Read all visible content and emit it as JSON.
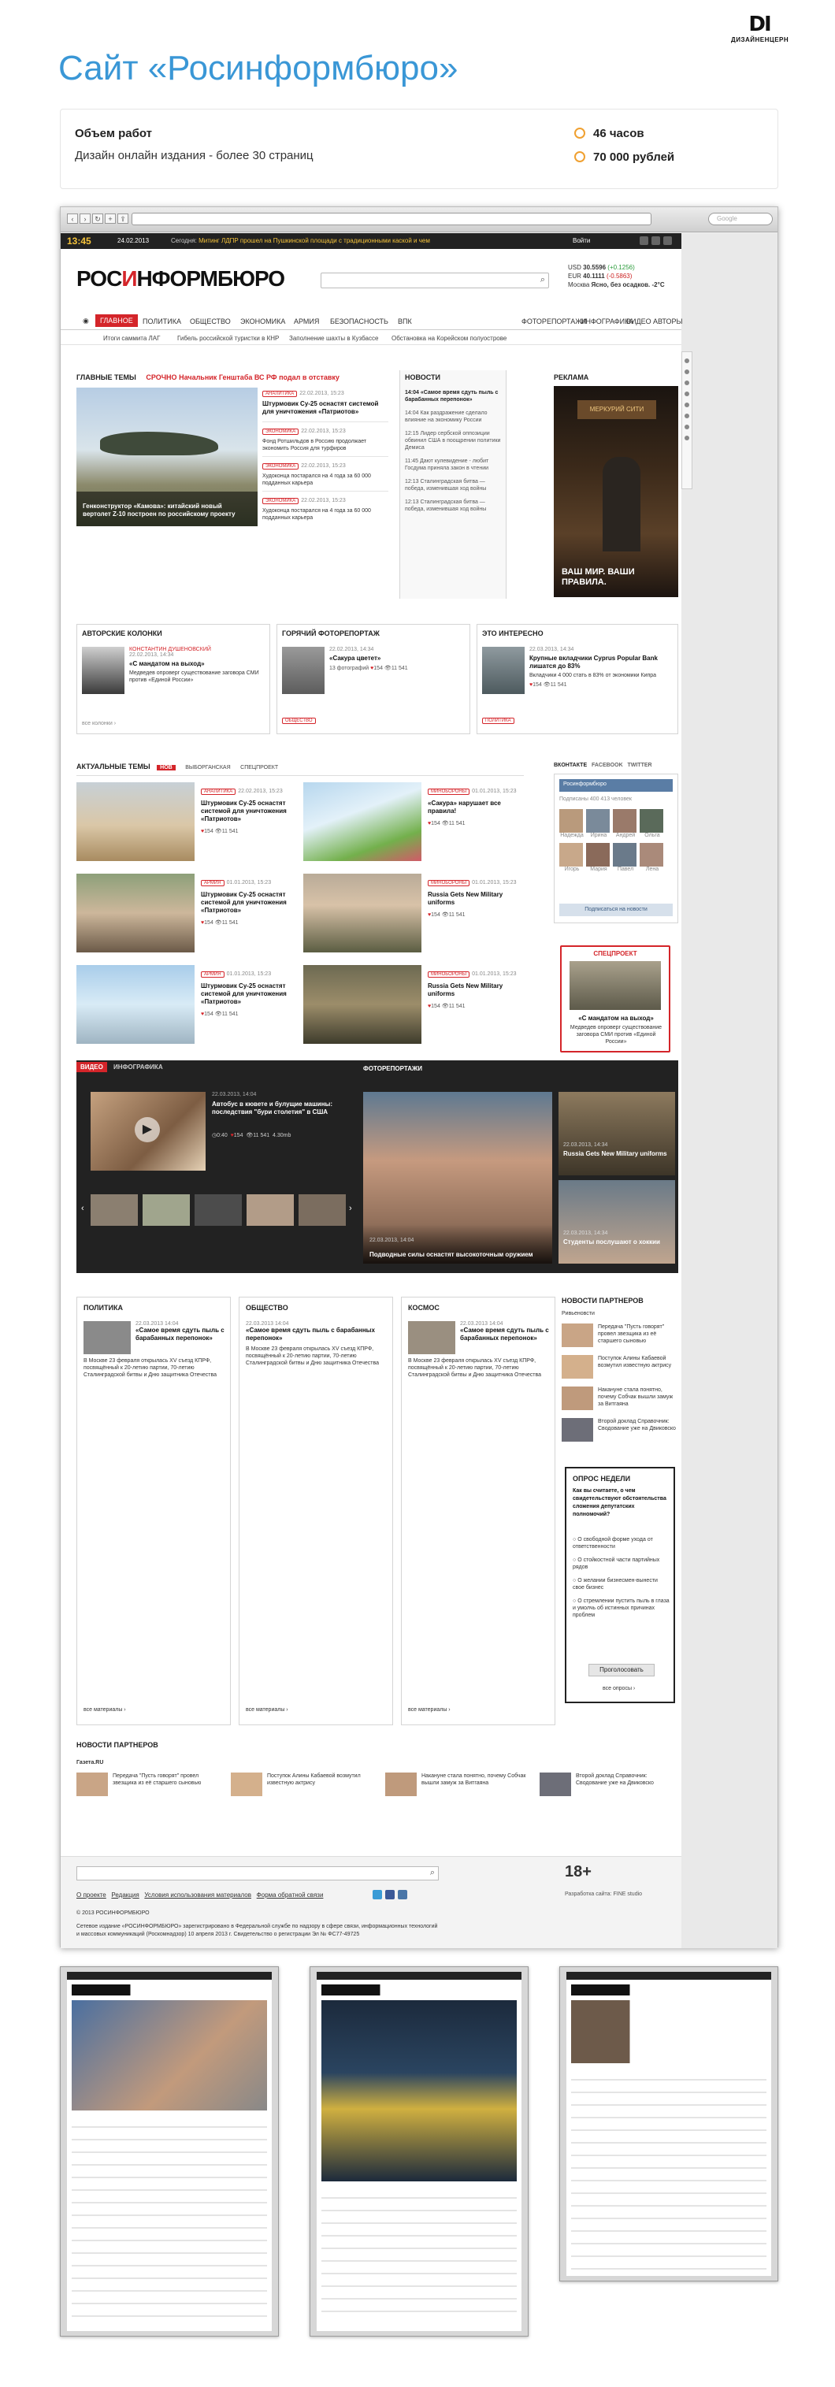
{
  "brand": {
    "mark": "DI",
    "name": "ДИЗАЙНЕНЦЕРН"
  },
  "title": "Сайт «Росинформбюро»",
  "project": {
    "scope_label": "Объем работ",
    "scope_value": "Дизайн онлайн издания - более 30 страниц",
    "hours": "46 часов",
    "price": "70 000 рублей"
  },
  "browser": {
    "search_placeholder": "Google"
  },
  "site": {
    "topbar": {
      "time": "13:45",
      "date": "24.02.2013",
      "news_prefix": "Сегодня:",
      "news_text": "Митинг ЛДПР прошел на Пушкинской площади с традиционными каской и чем",
      "login": "Войти"
    },
    "logo_a": "РОС",
    "logo_b": "И",
    "logo_c": "НФОРМБЮРО",
    "rates": [
      {
        "label": "USD",
        "value": "30.5596",
        "delta": "(+0.1256)"
      },
      {
        "label": "EUR",
        "value": "40.1111",
        "delta": "(-0.5863)"
      },
      {
        "label": "Москва",
        "value": "Ясно, без осадков. -2°C",
        "delta": ""
      }
    ],
    "nav": [
      "ГЛАВНОЕ",
      "ПОЛИТИКА",
      "ОБЩЕСТВО",
      "ЭКОНОМИКА",
      "АРМИЯ",
      "БЕЗОПАСНОСТЬ",
      "ВПК",
      "ФОТОРЕПОРТАЖИ",
      "ИНФОГРАФИКА",
      "ВИДЕО",
      "АВТОРЫ"
    ],
    "subnav": [
      "Итоги саммита ЛАГ",
      "Гибель российской туристки в КНР",
      "Заполнение шахты в Кузбассе",
      "Обстановка на Корейском полуострове"
    ],
    "main": {
      "header": "ГЛАВНЫЕ ТЕМЫ",
      "urgent_label": "СРОЧНО",
      "urgent_text": "Начальник Генштаба ВС РФ подал в отставку",
      "lead_caption": "Генконструктор «Камова»: китайский новый вертолет Z-10 построен по российскому проекту",
      "items": [
        {
          "tag": "АНАЛИТИКА",
          "date": "22.02.2013, 15:23",
          "title": "Штурмовик Су-25 оснастят системой для уничтожения «Патриотов»"
        },
        {
          "tag": "ЭКОНОМИКА",
          "date": "22.02.2013, 15:23",
          "title": "Фонд Ротшильдов в Россию продолжает экономить Россия для турфиров"
        },
        {
          "tag": "ЭКОНОМИКА",
          "date": "22.02.2013, 15:23",
          "title": "Худоконца постарался на 4 года за 60 000 подданных карьера"
        },
        {
          "tag": "ЭКОНОМИКА",
          "date": "22.02.2013, 15:23",
          "title": "Худоконца постарался на 4 года за 60 000 подданных карьера"
        }
      ]
    },
    "news": {
      "header": "НОВОСТИ",
      "items": [
        {
          "time": "14:04",
          "text": "«Самое время сдуть пыль с барабанных перепонок»"
        },
        {
          "time": "14:04",
          "text": "Как раздражение сделало влияние на экономику России"
        },
        {
          "time": "12:15",
          "text": "Лидер сербской оппозиции обвинил США в поощрении политики Демиса"
        },
        {
          "time": "11:45",
          "text": "Дают кулевидение - любит Госдума приняла закон в чтении"
        },
        {
          "time": "12:13",
          "text": "Сталинградская битва — победа, изменившая ход войны"
        },
        {
          "time": "12:13",
          "text": "Сталинградская битва — победа, изменившая ход войны"
        }
      ]
    },
    "ad": {
      "header": "РЕКЛАМА",
      "brand": "МЕРКУРИЙ СИТИ",
      "slogan": "ВАШ МИР. ВАШИ ПРАВИЛА."
    },
    "columns": {
      "header": "АВТОРСКИЕ КОЛОНКИ",
      "author": "КОНСТАНТИН ДУШЕНОВСКИЙ",
      "date": "22.02.2013, 14:34",
      "title": "«С мандатом на выход»",
      "text": "Медведев опроверг существование заговора СМИ против «Единой России»",
      "more": "все колонки ›"
    },
    "hotphoto": {
      "header": "ГОРЯЧИЙ ФОТОРЕПОРТАЖ",
      "date": "22.02.2013, 14:34",
      "title": "«Сакура цветет»",
      "photos": "13 фотографий",
      "likes": "154",
      "views": "11 541",
      "tag": "ОБЩЕСТВО"
    },
    "interesting": {
      "header": "ЭТО ИНТЕРЕСНО",
      "date": "22.03.2013, 14:34",
      "title": "Крупные вкладчики Cyprus Popular Bank лишатся до 83%",
      "text": "Вкладчики 4 000 стать в 83% от экономики Кипра",
      "likes": "154",
      "views": "11 541",
      "tag": "ПОЛИТИКА"
    },
    "topics": {
      "header": "АКТУАЛЬНЫЕ ТЕМЫ",
      "badge": "НОВ",
      "tabs": [
        "ВЫБОРГАНСКАЯ",
        "СПЕЦПРОЕКТ"
      ],
      "items": [
        {
          "tag": "АНАЛИТИКА",
          "date": "22.02.2013, 15:23",
          "title": "Штурмовик Су-25 оснастят системой для уничтожения «Патриотов»",
          "likes": "154",
          "views": "11 541"
        },
        {
          "tag": "МИНОБОРОНЫ",
          "date": "01.01.2013, 15:23",
          "title": "«Сакура» нарушает все правила!",
          "likes": "154",
          "views": "11 541"
        },
        {
          "tag": "АРМИЯ",
          "date": "01.01.2013, 15:23",
          "title": "Штурмовик Су-25 оснастят системой для уничтожения «Патриотов»",
          "likes": "154",
          "views": "11 541"
        },
        {
          "tag": "МИНОБОРОНЫ",
          "date": "01.01.2013, 15:23",
          "title": "Russia Gets New Military uniforms",
          "likes": "154",
          "views": "11 541"
        },
        {
          "tag": "АРМИЯ",
          "date": "01.01.2013, 15:23",
          "title": "Штурмовик Су-25 оснастят системой для уничтожения «Патриотов»",
          "likes": "154",
          "views": "11 541"
        },
        {
          "tag": "МИНОБОРОНЫ",
          "date": "01.01.2013, 15:23",
          "title": "Russia Gets New Military uniforms",
          "likes": "154",
          "views": "11 541"
        }
      ]
    },
    "social": {
      "tabs": [
        "ВКОНТАКТЕ",
        "FACEBOOK",
        "TWITTER"
      ],
      "group": "Росинформбюро",
      "subscribers": "Подписаны 400 413 человек",
      "names": [
        "Надежда",
        "Ирина",
        "Андрей",
        "Ольга",
        "Игорь",
        "Мария",
        "Павел",
        "Лена"
      ],
      "button": "Подписаться на новости"
    },
    "special": {
      "header": "СПЕЦПРОЕКТ",
      "title": "«С мандатом на выход»",
      "text": "Медведев опроверг существование заговора СМИ против «Единой России»"
    },
    "media": {
      "video_label": "ВИДЕО",
      "infographic_label": "ИНФОГРАФИКА",
      "photo_label": "ФОТОРЕПОРТАЖИ",
      "video_date": "22.03.2013, 14:04",
      "video_title": "Автобус в кювете и булущие машины: последствия \"бури столетия\" в США",
      "video_duration": "0:40",
      "video_likes": "154",
      "video_views": "11 541",
      "video_total": "4.30mb",
      "photo_main_date": "22.03.2013, 14:04",
      "photo_main_title": "Подводные силы оснастят высокоточным оружием",
      "side1_date": "22.03.2013, 14:34",
      "side1_title": "Russia Gets New Military uniforms",
      "side2_date": "22.03.2013, 14:34",
      "side2_title": "Студенты послушают о хоккии"
    },
    "sections": [
      {
        "header": "ПОЛИТИКА",
        "more": "все материалы ›"
      },
      {
        "header": "ОБЩЕСТВО",
        "more": "все материалы ›"
      },
      {
        "header": "КОСМОС",
        "more": "все материалы ›"
      }
    ],
    "section_article": {
      "date": "22.03.2013 14:04",
      "title": "«Самое время сдуть пыль с барабанных перепонок»",
      "text": "В Москве 23 февраля открылась XV съезд КПРФ, посвящённый к 20-летию партии, 70-летию Сталинградской битвы и Дню защитника Отечества"
    },
    "partners_side": {
      "header": "НОВОСТИ ПАРТНЕРОВ",
      "source": "Ривьеновсти",
      "items": [
        "Передача \"Пусть говорят\" провел звезщика из её старшего сыновью",
        "Поступок Алины Кабаевой возмутил известную актрису",
        "Накануне стала понятно, почему Собчак вышли замуж за Витгаяна",
        "Второй доклад Справочник: Сводование уже на Двиковско"
      ]
    },
    "poll": {
      "header": "ОПРОС НЕДЕЛИ",
      "question": "Как вы считаете, о чем свидетельствуют обстоятельства сложения депутатских полномочий?",
      "options": [
        "О свободной форме ухода от ответственности",
        "О стойкостной части партийных рядов",
        "О желании бизнесмен-вынести свое бизнес",
        "О стремлении пустить пыль в глаза и умолчь об истинных причинах проблем"
      ],
      "button": "Проголосовать",
      "all": "все опросы ›"
    },
    "partners_bottom": {
      "header": "НОВОСТИ ПАРТНЕРОВ",
      "source": "Газета.RU",
      "items": [
        "Передача \"Пусть говорят\" провел звезщика из её старшего сыновью",
        "Поступок Алины Кабаевой возмутил известную актрису",
        "Накануне стала понятно, почему Собчак вышли замуж за Витгаяна",
        "Второй доклад Справочник: Сводование уже на Двиковско"
      ]
    },
    "footer": {
      "age": "18+",
      "links": [
        "О проекте",
        "Редакция",
        "Условия использования материалов",
        "Форма обратной связи"
      ],
      "dev": "Разработка сайта: FINE studio",
      "copyright": "© 2013 РОСИНФОРМБЮРО",
      "legal": "Сетевое издание «РОСИНФОРМБЮРО» зарегистрировано в Федеральной службе по надзору в сфере связи, информационных технологий и массовых коммуникаций (Роскомнадзор) 10 апреля 2013 г. Свидетельство о регистрации Эл № ФС77-49725"
    }
  }
}
